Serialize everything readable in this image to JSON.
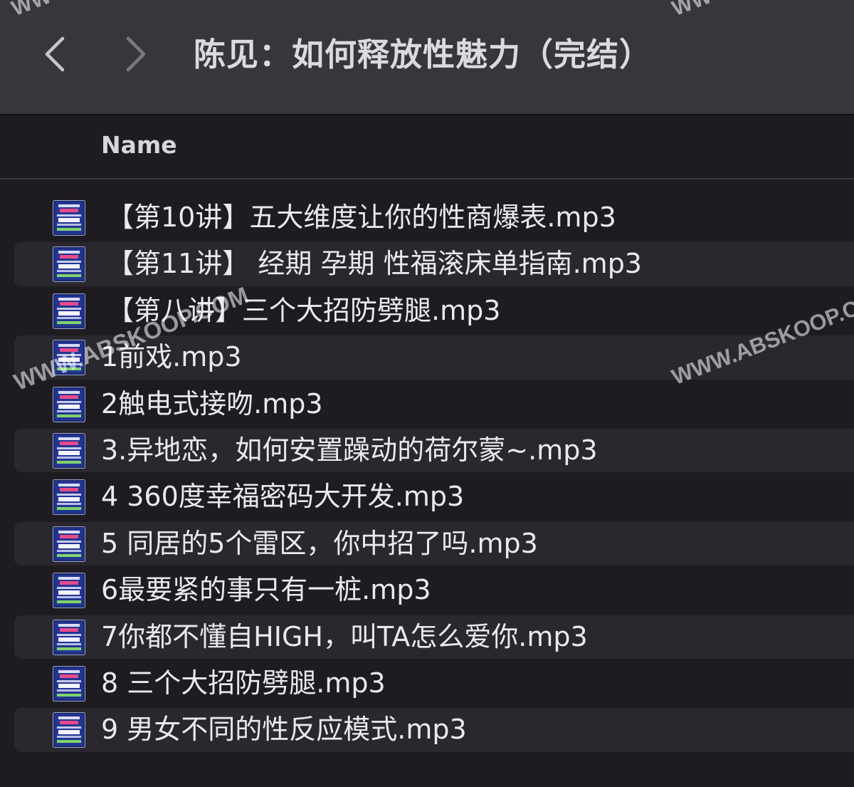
{
  "window": {
    "title": "陈见：如何释放性魅力（完结）"
  },
  "toolbar": {
    "back_icon": "chevron-left-icon",
    "forward_icon": "chevron-right-icon"
  },
  "list_header": {
    "name_label": "Name"
  },
  "files": [
    {
      "name": "【第10讲】五大维度让你的性商爆表.mp3",
      "icon": "audio-file-icon"
    },
    {
      "name": "【第11讲】 经期 孕期 性福滚床单指南.mp3",
      "icon": "audio-file-icon"
    },
    {
      "name": "【第八讲】三个大招防劈腿.mp3",
      "icon": "audio-file-icon"
    },
    {
      "name": "1前戏.mp3",
      "icon": "audio-file-icon"
    },
    {
      "name": "2触电式接吻.mp3",
      "icon": "audio-file-icon"
    },
    {
      "name": "3.异地恋，如何安置躁动的荷尔蒙~.mp3",
      "icon": "audio-file-icon"
    },
    {
      "name": "4 360度幸福密码大开发.mp3",
      "icon": "audio-file-icon"
    },
    {
      "name": "5 同居的5个雷区，你中招了吗.mp3",
      "icon": "audio-file-icon"
    },
    {
      "name": "6最要紧的事只有一桩.mp3",
      "icon": "audio-file-icon"
    },
    {
      "name": "7你都不懂自HIGH，叫TA怎么爱你.mp3",
      "icon": "audio-file-icon"
    },
    {
      "name": "8 三个大招防劈腿.mp3",
      "icon": "audio-file-icon"
    },
    {
      "name": "9 男女不同的性反应模式.mp3",
      "icon": "audio-file-icon"
    }
  ],
  "watermarks": {
    "center": "WWW.ABSKOOP.COM",
    "right": "WWW.ABSKOOP.COM",
    "top_left": "WWW",
    "top_right": "WWW"
  },
  "colors": {
    "titlebar_bg": "#38363b",
    "window_bg": "#1e1b21",
    "alt_row_bg": "#2a272e",
    "text": "#ebe9ee"
  }
}
